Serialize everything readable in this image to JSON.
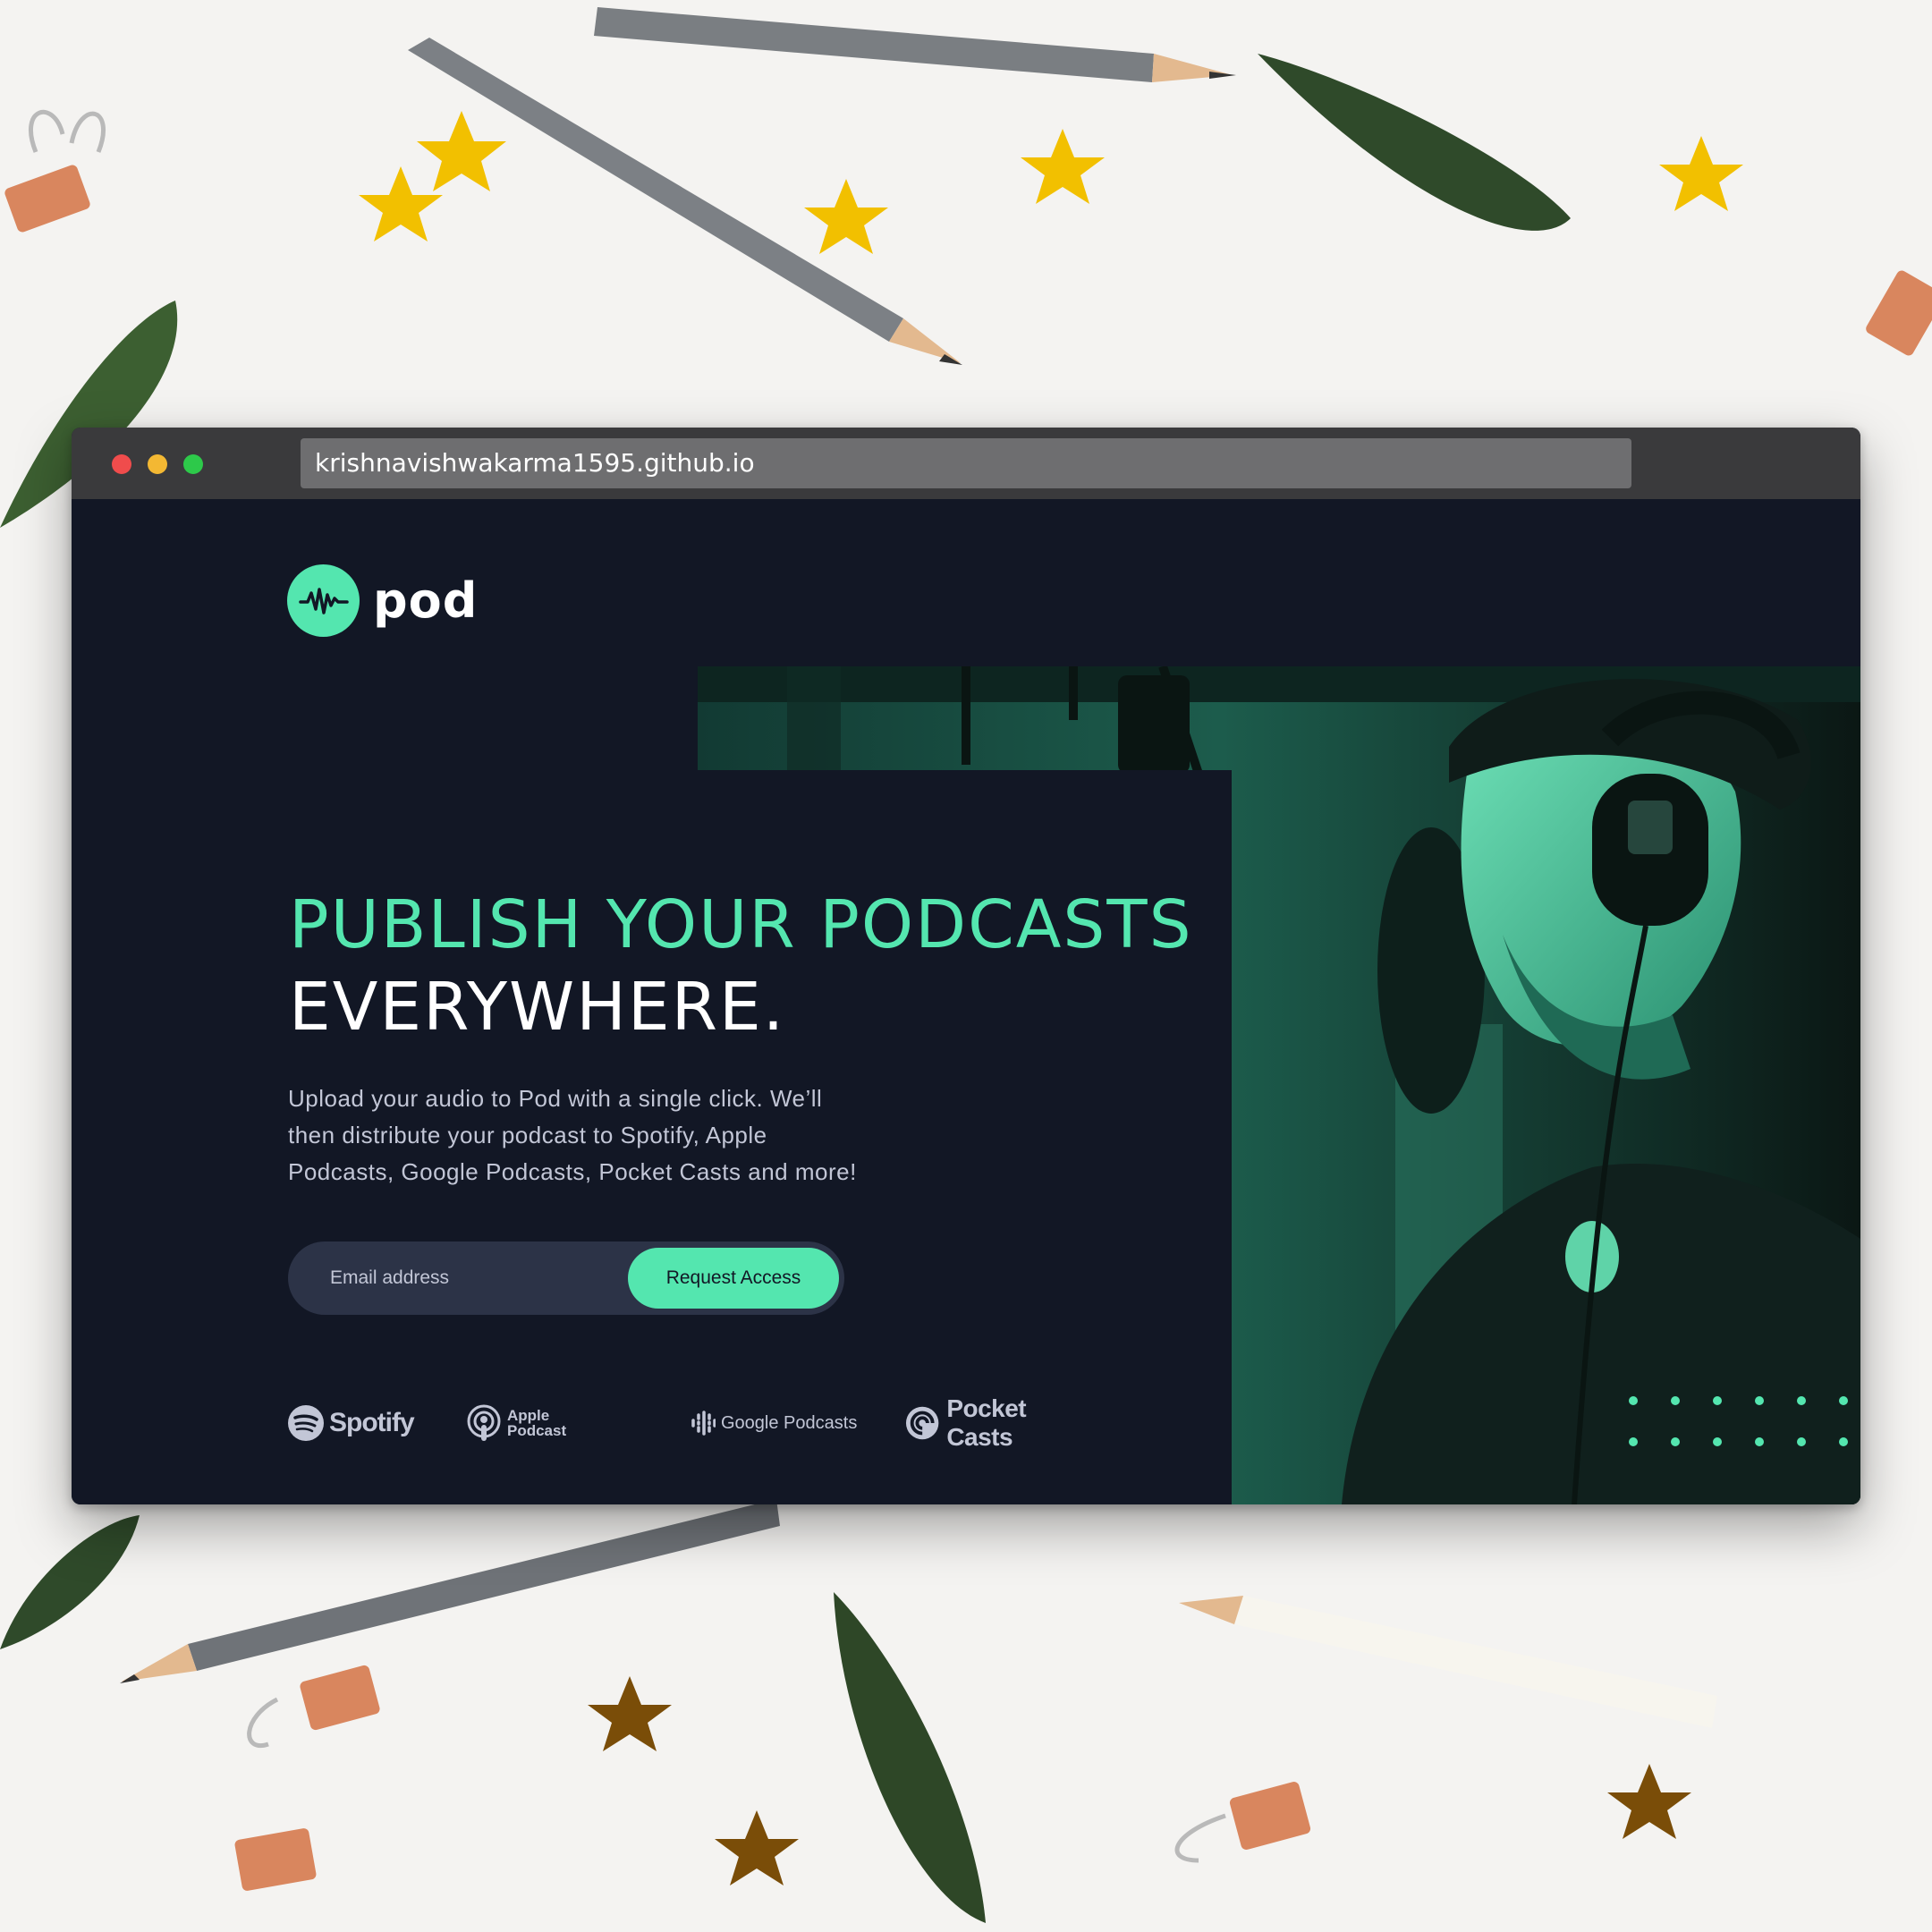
{
  "browser": {
    "url": "krishnavishwakarma1595.github.io"
  },
  "brand": {
    "name": "pod",
    "icon": "waveform-icon",
    "accent_color": "#54e6af",
    "background_color": "#121725"
  },
  "hero": {
    "headline_line1": "PUBLISH YOUR PODCASTS",
    "headline_line2": "EVERYWHERE.",
    "description": "Upload your audio to Pod with a single click. We’ll then distribute your podcast to Spotify, Apple Podcasts, Google Podcasts, Pocket Casts and more!"
  },
  "form": {
    "email_placeholder": "Email address",
    "button_label": "Request Access"
  },
  "platforms": [
    {
      "name": "Spotify",
      "icon": "spotify-icon"
    },
    {
      "name_line1": "Apple",
      "name_line2": "Podcast",
      "icon": "apple-podcasts-icon"
    },
    {
      "name": "Google Podcasts",
      "icon": "google-podcasts-icon"
    },
    {
      "name": "Pocket Casts",
      "icon": "pocket-casts-icon"
    }
  ]
}
